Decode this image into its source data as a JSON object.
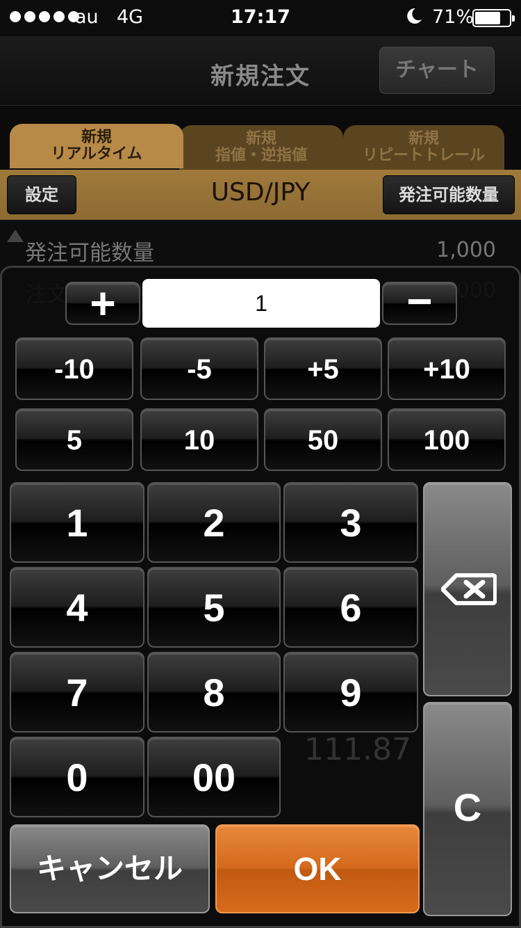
{
  "status_bar": {
    "carrier": "au",
    "network": "4G",
    "time": "17:17",
    "battery": "71%",
    "battery_level": 0.71
  },
  "nav": {
    "title": "新規注文",
    "chart_button": "チャート"
  },
  "tabs": [
    {
      "line1": "新規",
      "line2": "リアルタイム",
      "active": true
    },
    {
      "line1": "新規",
      "line2": "指値・逆指値",
      "active": false
    },
    {
      "line1": "新規",
      "line2": "リピートトレール",
      "active": false
    }
  ],
  "toolbar": {
    "settings_label": "設定",
    "currency_pair": "USD/JPY",
    "available_qty_label": "発注可能数量"
  },
  "background": {
    "available_qty_label": "発注可能数量",
    "available_qty_value": "1,000",
    "order_qty_label": "注文",
    "order_qty_value": "000",
    "price": "111.87"
  },
  "keypad": {
    "plus": "+",
    "minus": "−",
    "value": "1",
    "steps": [
      "-10",
      "-5",
      "+5",
      "+10"
    ],
    "presets": [
      "5",
      "10",
      "50",
      "100"
    ],
    "digits": [
      "1",
      "2",
      "3",
      "4",
      "5",
      "6",
      "7",
      "8",
      "9",
      "0",
      "00"
    ],
    "clear": "C",
    "cancel": "キャンセル",
    "ok": "OK"
  },
  "colors": {
    "accent_gold": "#b78a48",
    "ok_orange": "#d46a1c"
  }
}
